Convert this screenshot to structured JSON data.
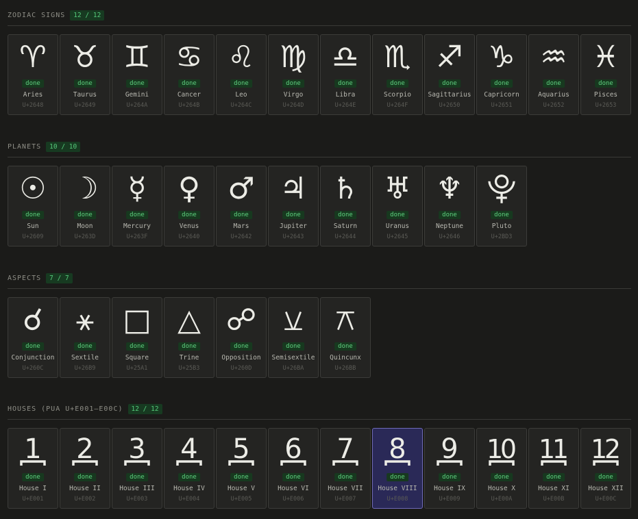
{
  "sections": [
    {
      "title": "ZODIAC SIGNS",
      "count": "12 / 12",
      "items": [
        {
          "glyph": "♈",
          "name": "Aries",
          "code": "U+2648",
          "status": "done"
        },
        {
          "glyph": "♉",
          "name": "Taurus",
          "code": "U+2649",
          "status": "done"
        },
        {
          "glyph": "♊",
          "name": "Gemini",
          "code": "U+264A",
          "status": "done"
        },
        {
          "glyph": "♋",
          "name": "Cancer",
          "code": "U+264B",
          "status": "done"
        },
        {
          "glyph": "♌",
          "name": "Leo",
          "code": "U+264C",
          "status": "done"
        },
        {
          "glyph": "♍",
          "name": "Virgo",
          "code": "U+264D",
          "status": "done"
        },
        {
          "glyph": "♎",
          "name": "Libra",
          "code": "U+264E",
          "status": "done"
        },
        {
          "glyph": "♏",
          "name": "Scorpio",
          "code": "U+264F",
          "status": "done"
        },
        {
          "glyph": "♐",
          "name": "Sagittarius",
          "code": "U+2650",
          "status": "done"
        },
        {
          "glyph": "♑",
          "name": "Capricorn",
          "code": "U+2651",
          "status": "done"
        },
        {
          "glyph": "♒",
          "name": "Aquarius",
          "code": "U+2652",
          "status": "done"
        },
        {
          "glyph": "♓",
          "name": "Pisces",
          "code": "U+2653",
          "status": "done"
        }
      ]
    },
    {
      "title": "PLANETS",
      "count": "10 / 10",
      "items": [
        {
          "glyph": "☉",
          "name": "Sun",
          "code": "U+2609",
          "status": "done"
        },
        {
          "glyph": "☽",
          "name": "Moon",
          "code": "U+263D",
          "status": "done"
        },
        {
          "glyph": "☿",
          "name": "Mercury",
          "code": "U+263F",
          "status": "done"
        },
        {
          "glyph": "♀",
          "name": "Venus",
          "code": "U+2640",
          "status": "done"
        },
        {
          "glyph": "♂",
          "name": "Mars",
          "code": "U+2642",
          "status": "done"
        },
        {
          "glyph": "♃",
          "name": "Jupiter",
          "code": "U+2643",
          "status": "done"
        },
        {
          "glyph": "♄",
          "name": "Saturn",
          "code": "U+2644",
          "status": "done"
        },
        {
          "glyph": "♅",
          "name": "Uranus",
          "code": "U+2645",
          "status": "done"
        },
        {
          "glyph": "♆",
          "name": "Neptune",
          "code": "U+2646",
          "status": "done"
        },
        {
          "glyph": "⯓",
          "name": "Pluto",
          "code": "U+2BD3",
          "status": "done"
        }
      ]
    },
    {
      "title": "ASPECTS",
      "count": "7 / 7",
      "items": [
        {
          "glyph": "☌",
          "name": "Conjunction",
          "code": "U+260C",
          "status": "done"
        },
        {
          "glyph": "⚹",
          "name": "Sextile",
          "code": "U+26B9",
          "status": "done"
        },
        {
          "glyph": "□",
          "name": "Square",
          "code": "U+25A1",
          "status": "done"
        },
        {
          "glyph": "△",
          "name": "Trine",
          "code": "U+25B3",
          "status": "done"
        },
        {
          "glyph": "☍",
          "name": "Opposition",
          "code": "U+260D",
          "status": "done"
        },
        {
          "glyph": "⚺",
          "name": "Semisextile",
          "code": "U+26BA",
          "status": "done"
        },
        {
          "glyph": "⚻",
          "name": "Quincunx",
          "code": "U+26BB",
          "status": "done"
        }
      ]
    },
    {
      "title": "HOUSES (PUA U+E001–E00C)",
      "count": "12 / 12",
      "items": [
        {
          "glyph": "1",
          "name": "House I",
          "code": "U+E001",
          "status": "done"
        },
        {
          "glyph": "2",
          "name": "House II",
          "code": "U+E002",
          "status": "done"
        },
        {
          "glyph": "3",
          "name": "House III",
          "code": "U+E003",
          "status": "done"
        },
        {
          "glyph": "4",
          "name": "House IV",
          "code": "U+E004",
          "status": "done"
        },
        {
          "glyph": "5",
          "name": "House V",
          "code": "U+E005",
          "status": "done"
        },
        {
          "glyph": "6",
          "name": "House VI",
          "code": "U+E006",
          "status": "done"
        },
        {
          "glyph": "7",
          "name": "House VII",
          "code": "U+E007",
          "status": "done"
        },
        {
          "glyph": "8",
          "name": "House VIII",
          "code": "U+E008",
          "status": "done",
          "selected": true
        },
        {
          "glyph": "9",
          "name": "House IX",
          "code": "U+E009",
          "status": "done"
        },
        {
          "glyph": "10",
          "name": "House X",
          "code": "U+E00A",
          "status": "done"
        },
        {
          "glyph": "11",
          "name": "House XI",
          "code": "U+E00B",
          "status": "done"
        },
        {
          "glyph": "12",
          "name": "House XII",
          "code": "U+E00C",
          "status": "done"
        }
      ]
    }
  ],
  "colors": {
    "accent_done": "#5fd07f",
    "selected_bg": "#2a2957",
    "selected_border": "#6f6ab8"
  }
}
